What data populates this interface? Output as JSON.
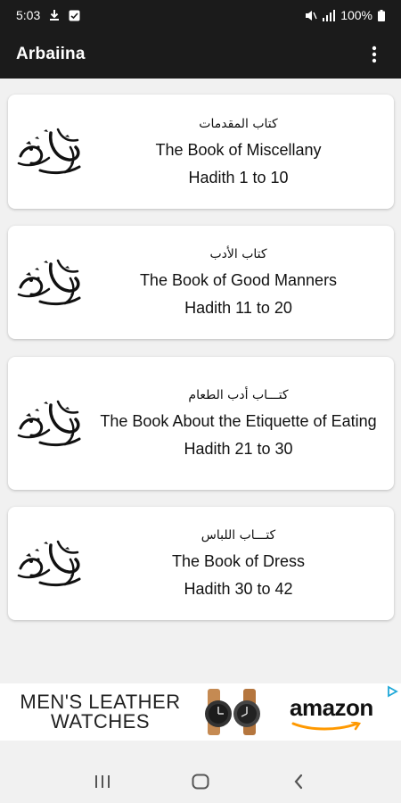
{
  "status": {
    "time": "5:03",
    "battery": "100%"
  },
  "app": {
    "title": "Arbaiina"
  },
  "books": [
    {
      "arabic": "كتاب المقدمات",
      "title": "The Book of Miscellany",
      "range": "Hadith 1 to 10"
    },
    {
      "arabic": "كتاب الأدب",
      "title": "The Book of Good Manners",
      "range": "Hadith 11 to 20"
    },
    {
      "arabic": "كتـــاب أدب الطعام",
      "title": "The Book About the Etiquette of Eating",
      "range": "Hadith 21 to 30"
    },
    {
      "arabic": "كتـــاب اللباس",
      "title": "The Book of Dress",
      "range": "Hadith 30 to 42"
    }
  ],
  "ad": {
    "line1": "MEN'S LEATHER",
    "line2": "WATCHES",
    "brand": "amazon"
  },
  "colors": {
    "bar": "#1b1b1b",
    "background": "#f1f1f1",
    "card": "#ffffff",
    "ad_choices": "#1fa8d8",
    "amazon_orange": "#ff9900"
  },
  "icons": {
    "calligraphy": "muhammad-calligraphy-icon",
    "overflow": "more-vert-icon"
  }
}
